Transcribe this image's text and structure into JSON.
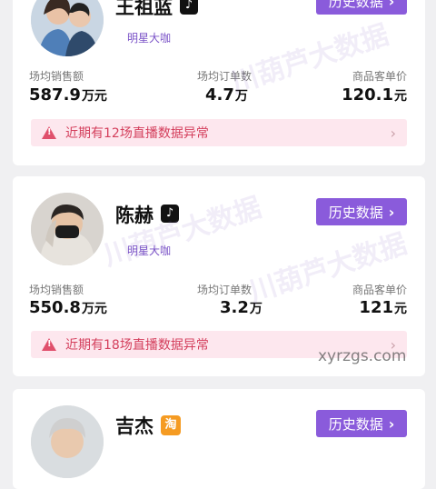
{
  "streamers": [
    {
      "name": "王祖蓝",
      "platform_icon": "tiktok-icon",
      "tag": "明星大咖",
      "history_button": "历史数据",
      "stats": [
        {
          "label": "场均销售额",
          "value": "587.9",
          "unit": "万元"
        },
        {
          "label": "场均订单数",
          "value": "4.7",
          "unit": "万"
        },
        {
          "label": "商品客单价",
          "value": "120.1",
          "unit": "元"
        }
      ],
      "alert": "近期有12场直播数据异常"
    },
    {
      "name": "陈赫",
      "platform_icon": "tiktok-icon",
      "tag": "明星大咖",
      "history_button": "历史数据",
      "stats": [
        {
          "label": "场均销售额",
          "value": "550.8",
          "unit": "万元"
        },
        {
          "label": "场均订单数",
          "value": "3.2",
          "unit": "万"
        },
        {
          "label": "商品客单价",
          "value": "121",
          "unit": "元"
        }
      ],
      "alert": "近期有18场直播数据异常"
    },
    {
      "name": "吉杰",
      "platform_icon": "taobao-icon",
      "platform_glyph": "淘",
      "history_button": "历史数据"
    }
  ],
  "watermark": "川葫芦大数据",
  "site_watermark": "xyrzgs.com",
  "colors": {
    "accent": "#8a5bdb",
    "alert_bg": "#fde7ee",
    "alert_text": "#d43f5c"
  }
}
